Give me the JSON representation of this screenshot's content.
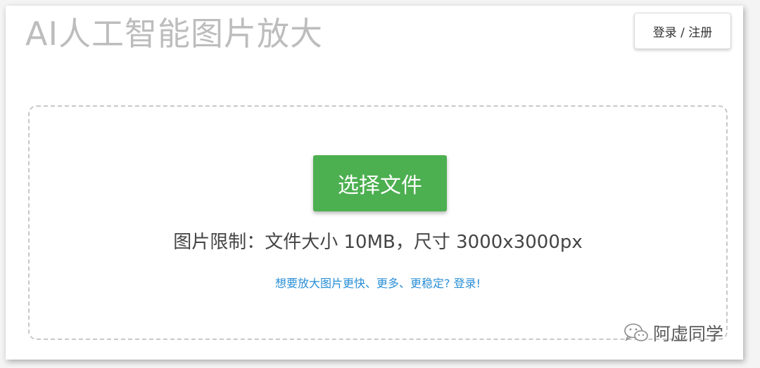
{
  "header": {
    "title": "AI人工智能图片放大",
    "login_label": "登录 / 注册"
  },
  "upload": {
    "choose_label": "选择文件",
    "limits_text": "图片限制：文件大小 10MB，尺寸 3000x3000px",
    "login_hint": "想要放大图片更快、更多、更稳定? 登录!"
  },
  "watermark": {
    "icon": "wechat-icon",
    "text": "阿虚同学"
  },
  "colors": {
    "accent_green": "#4caf50",
    "link_blue": "#2a8fd6",
    "title_gray": "#bdbdbd"
  }
}
